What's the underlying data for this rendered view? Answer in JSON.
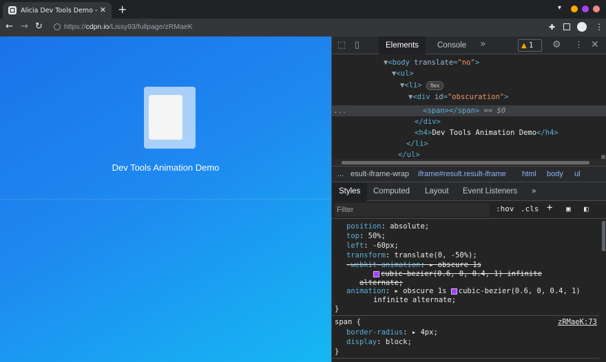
{
  "browser": {
    "tab_title": "Alicia Dev Tools Demo - Anim",
    "tab_close": "✕",
    "new_tab": "+",
    "url_prefix": "https://",
    "url_host": "cdpn.io",
    "url_path": "/Lissy93/fullpage/zRMaeK",
    "window_controls": [
      "#f9ab00",
      "#a142f4",
      "#f28b82"
    ]
  },
  "page": {
    "title": "Dev Tools Animation Demo"
  },
  "devtools": {
    "tabs": [
      "Elements",
      "Console"
    ],
    "more": "»",
    "warning_count": "1",
    "dom": {
      "l0": "<body translate=\"no\">",
      "body_open": "body",
      "body_attr": "translate",
      "body_val": "\"no\"",
      "ul": "ul",
      "li": "li",
      "flex_badge": "flex",
      "div": "div",
      "div_attr": "id",
      "div_val": "\"obscuration\"",
      "span": "span",
      "selected_suffix": "== $0",
      "div_close": "div",
      "h4": "h4",
      "h4_text": "Dev Tools Animation Demo",
      "li_close": "li",
      "ul_close": "ul",
      "ellipsis": "..."
    },
    "breadcrumbs": {
      "ellipsis": "...",
      "items": [
        "esult-iframe-wrap",
        "iframe#result.result-iframe",
        "html",
        "body",
        "ul"
      ]
    },
    "styles_tabs": [
      "Styles",
      "Computed",
      "Layout",
      "Event Listeners"
    ],
    "filter_placeholder": "Filter",
    "hov": ":hov",
    ".cls": ".cls",
    "plus": "+",
    "rules": {
      "position_prop": "position",
      "position_val": "absolute;",
      "top_prop": "top",
      "top_val": "50%;",
      "left_prop": "left",
      "left_val": "-60px;",
      "transform_prop": "transform",
      "transform_val": "translate(0, -50%);",
      "webkit_prop": "-webkit-animation",
      "webkit_val1": "obscure 1s",
      "webkit_val2": "cubic-bezier(0.6, 0, 0.4, 1) infinite",
      "webkit_val3": "alternate;",
      "anim_prop": "animation",
      "anim_val1": "obscure 1s",
      "anim_val2": "cubic-bezier(0.6, 0, 0.4, 1)",
      "anim_val3": "infinite alternate;",
      "close_brace": "}",
      "span_selector": "span {",
      "span_source": "zRMaeK:73",
      "br_prop": "border-radius",
      "br_val": "4px;",
      "display_prop": "display",
      "display_val": "block;"
    }
  }
}
